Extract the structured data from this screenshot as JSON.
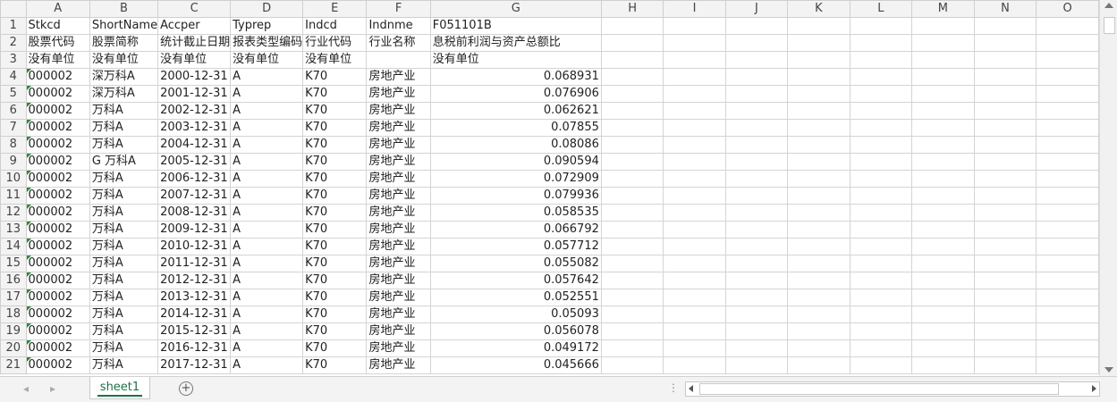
{
  "columns": [
    "A",
    "B",
    "C",
    "D",
    "E",
    "F",
    "G",
    "H",
    "I",
    "J",
    "K",
    "L",
    "M",
    "N",
    "O"
  ],
  "rows": [
    {
      "n": "1",
      "c": [
        "Stkcd",
        "ShortName",
        "Accper",
        "Typrep",
        "Indcd",
        "Indnme",
        "F051101B"
      ]
    },
    {
      "n": "2",
      "c": [
        "股票代码",
        "股票简称",
        "统计截止日期",
        "报表类型编码",
        "行业代码",
        "行业名称",
        "息税前利润与资产总额比"
      ]
    },
    {
      "n": "3",
      "c": [
        "没有单位",
        "没有单位",
        "没有单位",
        "没有单位",
        "没有单位",
        "",
        "没有单位"
      ]
    },
    {
      "n": "4",
      "c": [
        "000002",
        "深万科A",
        "2000-12-31",
        "A",
        "K70",
        "房地产业",
        "0.068931"
      ]
    },
    {
      "n": "5",
      "c": [
        "000002",
        "深万科A",
        "2001-12-31",
        "A",
        "K70",
        "房地产业",
        "0.076906"
      ]
    },
    {
      "n": "6",
      "c": [
        "000002",
        "万科A",
        "2002-12-31",
        "A",
        "K70",
        "房地产业",
        "0.062621"
      ]
    },
    {
      "n": "7",
      "c": [
        "000002",
        "万科A",
        "2003-12-31",
        "A",
        "K70",
        "房地产业",
        "0.07855"
      ]
    },
    {
      "n": "8",
      "c": [
        "000002",
        "万科A",
        "2004-12-31",
        "A",
        "K70",
        "房地产业",
        "0.08086"
      ]
    },
    {
      "n": "9",
      "c": [
        "000002",
        "G 万科A",
        "2005-12-31",
        "A",
        "K70",
        "房地产业",
        "0.090594"
      ]
    },
    {
      "n": "10",
      "c": [
        "000002",
        "万科A",
        "2006-12-31",
        "A",
        "K70",
        "房地产业",
        "0.072909"
      ]
    },
    {
      "n": "11",
      "c": [
        "000002",
        "万科A",
        "2007-12-31",
        "A",
        "K70",
        "房地产业",
        "0.079936"
      ]
    },
    {
      "n": "12",
      "c": [
        "000002",
        "万科A",
        "2008-12-31",
        "A",
        "K70",
        "房地产业",
        "0.058535"
      ]
    },
    {
      "n": "13",
      "c": [
        "000002",
        "万科A",
        "2009-12-31",
        "A",
        "K70",
        "房地产业",
        "0.066792"
      ]
    },
    {
      "n": "14",
      "c": [
        "000002",
        "万科A",
        "2010-12-31",
        "A",
        "K70",
        "房地产业",
        "0.057712"
      ]
    },
    {
      "n": "15",
      "c": [
        "000002",
        "万科A",
        "2011-12-31",
        "A",
        "K70",
        "房地产业",
        "0.055082"
      ]
    },
    {
      "n": "16",
      "c": [
        "000002",
        "万科A",
        "2012-12-31",
        "A",
        "K70",
        "房地产业",
        "0.057642"
      ]
    },
    {
      "n": "17",
      "c": [
        "000002",
        "万科A",
        "2013-12-31",
        "A",
        "K70",
        "房地产业",
        "0.052551"
      ]
    },
    {
      "n": "18",
      "c": [
        "000002",
        "万科A",
        "2014-12-31",
        "A",
        "K70",
        "房地产业",
        "0.05093"
      ]
    },
    {
      "n": "19",
      "c": [
        "000002",
        "万科A",
        "2015-12-31",
        "A",
        "K70",
        "房地产业",
        "0.056078"
      ]
    },
    {
      "n": "20",
      "c": [
        "000002",
        "万科A",
        "2016-12-31",
        "A",
        "K70",
        "房地产业",
        "0.049172"
      ]
    },
    {
      "n": "21",
      "c": [
        "000002",
        "万科A",
        "2017-12-31",
        "A",
        "K70",
        "房地产业",
        "0.045666"
      ]
    }
  ],
  "sheet_tab": "sheet1",
  "add_sheet": "+",
  "nav_prev": "◂",
  "nav_next": "▸",
  "dots": "⋮",
  "colors": {
    "accent": "#1e7145",
    "flag": "#2a8a3a"
  }
}
